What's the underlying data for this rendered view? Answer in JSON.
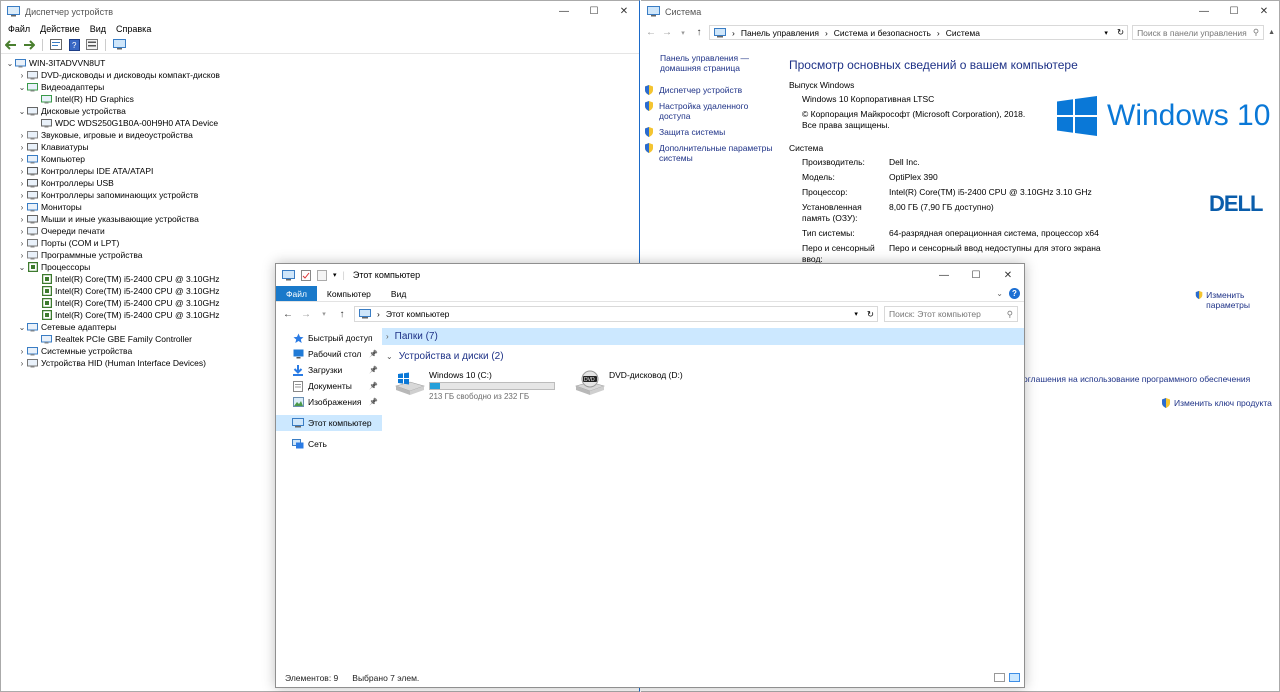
{
  "device_manager": {
    "title": "Диспетчер устройств",
    "menu": [
      "Файл",
      "Действие",
      "Вид",
      "Справка"
    ],
    "tree": [
      {
        "label": "WIN-3ITADVVN8UT",
        "level": 0,
        "expanded": true,
        "icon": "computer-icon"
      },
      {
        "label": "DVD-дисководы и дисководы компакт-дисков",
        "level": 1,
        "expanded": false,
        "icon": "dvd-icon"
      },
      {
        "label": "Видеоадаптеры",
        "level": 1,
        "expanded": true,
        "icon": "display-adapter-icon"
      },
      {
        "label": "Intel(R) HD Graphics",
        "level": 2,
        "icon": "display-adapter-icon"
      },
      {
        "label": "Дисковые устройства",
        "level": 1,
        "expanded": true,
        "icon": "disk-icon"
      },
      {
        "label": "WDC WDS250G1B0A-00H9H0 ATA Device",
        "level": 2,
        "icon": "disk-icon"
      },
      {
        "label": "Звуковые, игровые и видеоустройства",
        "level": 1,
        "expanded": false,
        "icon": "sound-icon"
      },
      {
        "label": "Клавиатуры",
        "level": 1,
        "expanded": false,
        "icon": "keyboard-icon"
      },
      {
        "label": "Компьютер",
        "level": 1,
        "expanded": false,
        "icon": "monitor-icon"
      },
      {
        "label": "Контроллеры IDE ATA/ATAPI",
        "level": 1,
        "expanded": false,
        "icon": "ide-icon"
      },
      {
        "label": "Контроллеры USB",
        "level": 1,
        "expanded": false,
        "icon": "usb-icon"
      },
      {
        "label": "Контроллеры запоминающих устройств",
        "level": 1,
        "expanded": false,
        "icon": "storage-icon"
      },
      {
        "label": "Мониторы",
        "level": 1,
        "expanded": false,
        "icon": "monitor-icon"
      },
      {
        "label": "Мыши и иные указывающие устройства",
        "level": 1,
        "expanded": false,
        "icon": "mouse-icon"
      },
      {
        "label": "Очереди печати",
        "level": 1,
        "expanded": false,
        "icon": "printer-icon"
      },
      {
        "label": "Порты (COM и LPT)",
        "level": 1,
        "expanded": false,
        "icon": "port-icon"
      },
      {
        "label": "Программные устройства",
        "level": 1,
        "expanded": false,
        "icon": "software-device-icon"
      },
      {
        "label": "Процессоры",
        "level": 1,
        "expanded": true,
        "icon": "cpu-icon"
      },
      {
        "label": "Intel(R) Core(TM) i5-2400 CPU @ 3.10GHz",
        "level": 2,
        "icon": "cpu-icon"
      },
      {
        "label": "Intel(R) Core(TM) i5-2400 CPU @ 3.10GHz",
        "level": 2,
        "icon": "cpu-icon"
      },
      {
        "label": "Intel(R) Core(TM) i5-2400 CPU @ 3.10GHz",
        "level": 2,
        "icon": "cpu-icon"
      },
      {
        "label": "Intel(R) Core(TM) i5-2400 CPU @ 3.10GHz",
        "level": 2,
        "icon": "cpu-icon"
      },
      {
        "label": "Сетевые адаптеры",
        "level": 1,
        "expanded": true,
        "icon": "network-adapter-icon"
      },
      {
        "label": "Realtek PCIe GBE Family Controller",
        "level": 2,
        "icon": "network-adapter-icon"
      },
      {
        "label": "Системные устройства",
        "level": 1,
        "expanded": false,
        "icon": "system-device-icon"
      },
      {
        "label": "Устройства HID (Human Interface Devices)",
        "level": 1,
        "expanded": false,
        "icon": "hid-icon"
      }
    ]
  },
  "system": {
    "title": "Система",
    "breadcrumb": [
      "Панель управления",
      "Система и безопасность",
      "Система"
    ],
    "search_placeholder": "Поиск в панели управления",
    "home_link": "Панель управления — домашняя страница",
    "left_links": [
      "Диспетчер устройств",
      "Настройка удаленного доступа",
      "Защита системы",
      "Дополнительные параметры системы"
    ],
    "heading": "Просмотр основных сведений о вашем компьютере",
    "edition_section": "Выпуск Windows",
    "edition": "Windows 10 Корпоративная LTSC",
    "copyright": "© Корпорация Майкрософт (Microsoft Corporation), 2018. Все права защищены.",
    "windows_logo_text": "Windows 10",
    "system_section": "Система",
    "specs": [
      {
        "k": "Производитель:",
        "v": "Dell Inc."
      },
      {
        "k": "Модель:",
        "v": "OptiPlex 390"
      },
      {
        "k": "Процессор:",
        "v": "Intel(R) Core(TM) i5-2400 CPU @ 3.10GHz   3.10 GHz"
      },
      {
        "k": "Установленная память (ОЗУ):",
        "v": "8,00 ГБ (7,90 ГБ доступно)"
      },
      {
        "k": "Тип системы:",
        "v": "64-разрядная операционная система, процессор x64"
      },
      {
        "k": "Перо и сенсорный ввод:",
        "v": "Перо и сенсорный ввод недоступны для этого экрана"
      }
    ],
    "dell_logo": "DELL",
    "change_params": "Изменить параметры",
    "license_link": "оглашения на использование программного обеспечения",
    "change_key": "Изменить ключ продукта"
  },
  "explorer": {
    "title": "Этот компьютер",
    "tabs": [
      "Файл",
      "Компьютер",
      "Вид"
    ],
    "address": "Этот компьютер",
    "search_placeholder": "Поиск: Этот компьютер",
    "nav": [
      {
        "label": "Быстрый доступ",
        "icon": "star-icon",
        "pinned": false
      },
      {
        "label": "Рабочий стол",
        "icon": "desktop-icon",
        "pinned": true
      },
      {
        "label": "Загрузки",
        "icon": "download-icon",
        "pinned": true
      },
      {
        "label": "Документы",
        "icon": "documents-icon",
        "pinned": true
      },
      {
        "label": "Изображения",
        "icon": "pictures-icon",
        "pinned": true
      },
      {
        "label": "Этот компьютер",
        "icon": "this-pc-icon",
        "pinned": false,
        "selected": true
      },
      {
        "label": "Сеть",
        "icon": "network-icon",
        "pinned": false
      }
    ],
    "folders_group": "Папки (7)",
    "devices_group": "Устройства и диски (2)",
    "drives": [
      {
        "name": "Windows 10 (C:)",
        "free": "213 ГБ свободно из 232 ГБ",
        "used_fraction": 0.08
      },
      {
        "name": "DVD-дисковод (D:)"
      }
    ],
    "status_items": "Элементов: 9",
    "status_selected": "Выбрано 7 элем."
  }
}
